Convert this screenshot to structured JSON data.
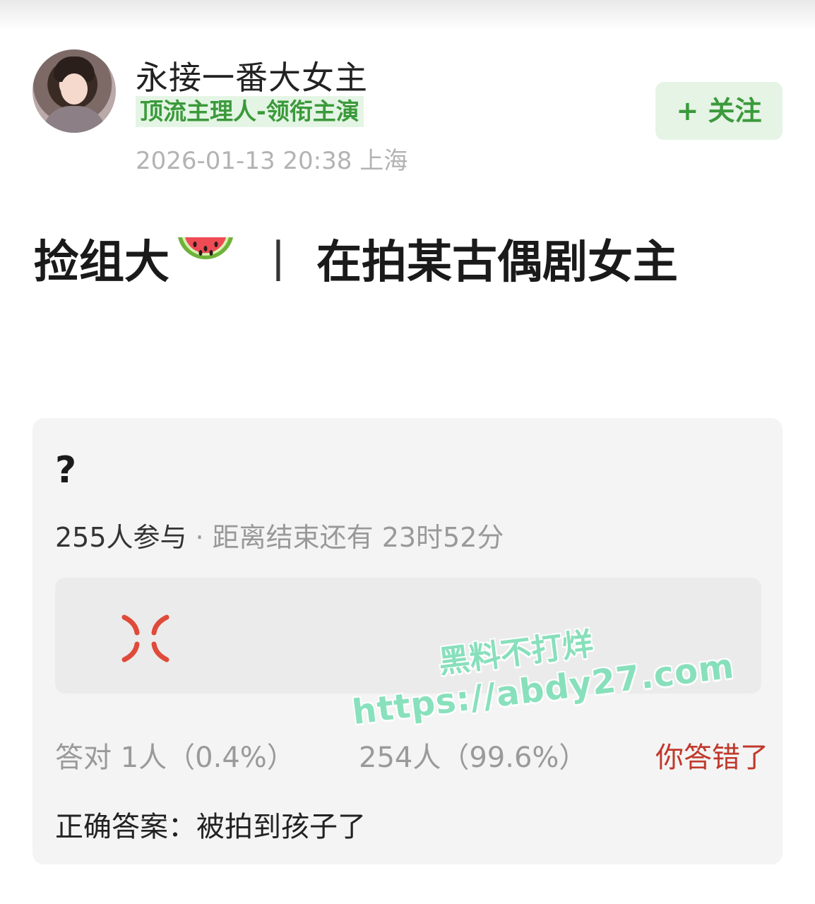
{
  "header": {
    "username": "永接一番大女主",
    "tag": "顶流主理人-领衔主演",
    "datetime": "2026-01-13 20:38",
    "location": "上海",
    "follow_label": "+ 关注"
  },
  "post": {
    "title_part1": "捡组大",
    "title_separator": "丨",
    "title_part2": "在拍某古偶剧女主",
    "title_emoji": "watermelon-emoji"
  },
  "quiz": {
    "question": "?",
    "participants": "255人参与",
    "dot": "·",
    "remaining": "距离结束还有 23时52分",
    "option_icon": "anger-symbol-icon",
    "correct_stat": "答对 1人（0.4%）",
    "wrong_stat": "254人（99.6%）",
    "your_result": "你答错了",
    "answer_label": "正确答案：",
    "answer_text": "被拍到孩子了",
    "correct_fraction": 0.004,
    "wrong_fraction": 0.996
  },
  "watermark": {
    "line1": "黑料不打烊",
    "line2": "https://abdy27.com"
  },
  "colors": {
    "accent_green": "#3b9a3b",
    "wrong_red": "#c0392b",
    "watermark_green": "#7fe0b8"
  }
}
